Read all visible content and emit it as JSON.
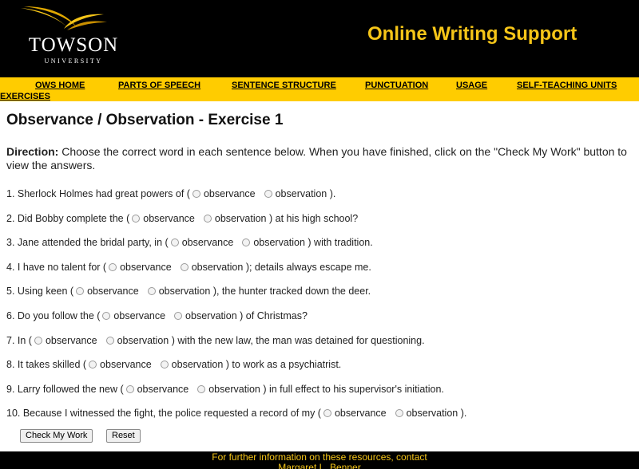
{
  "header": {
    "logo_name": "TOWSON",
    "logo_sub": "UNIVERSITY",
    "site_title": "Online Writing Support"
  },
  "nav": {
    "items": [
      {
        "label": "OWS HOME"
      },
      {
        "label": "PARTS OF SPEECH"
      },
      {
        "label": "SENTENCE STRUCTURE"
      },
      {
        "label": "PUNCTUATION"
      },
      {
        "label": "USAGE"
      },
      {
        "label": "SELF-TEACHING UNITS"
      },
      {
        "label": "EXERCISES"
      }
    ]
  },
  "main": {
    "title": "Observance / Observation - Exercise 1",
    "direction_label": "Direction:",
    "direction_text": " Choose the correct word in each sentence below. When you have finished, click on the \"Check My Work\" button to view the answers.",
    "option_a": "observance",
    "option_b": "observation",
    "questions": [
      {
        "before": "1. Sherlock Holmes had great powers of (",
        "after": ")."
      },
      {
        "before": "2. Did Bobby complete the (",
        "after": ") at his high school?"
      },
      {
        "before": "3. Jane attended the bridal party, in (",
        "after": ") with tradition."
      },
      {
        "before": "4. I have no talent for (",
        "after": "); details always escape me."
      },
      {
        "before": "5. Using keen (",
        "after": "), the hunter tracked down the deer."
      },
      {
        "before": "6. Do you follow the (",
        "after": ") of Christmas?"
      },
      {
        "before": "7. In (",
        "after": ") with the new law, the man was detained for questioning."
      },
      {
        "before": "8. It takes skilled (",
        "after": ") to work as a psychiatrist."
      },
      {
        "before": "9. Larry followed the new (",
        "after": ") in full effect to his supervisor's initiation."
      },
      {
        "before": "10. Because I witnessed the fight, the police requested a record of my (",
        "after": ")."
      }
    ],
    "check_button": "Check My Work",
    "reset_button": "Reset"
  },
  "footer": {
    "line1": "For further information on these resources, contact",
    "line2": "Margaret L. Benner"
  },
  "colors": {
    "header_bg": "#000000",
    "title_gold": "#f5c518",
    "nav_bg": "#ffcc00"
  }
}
